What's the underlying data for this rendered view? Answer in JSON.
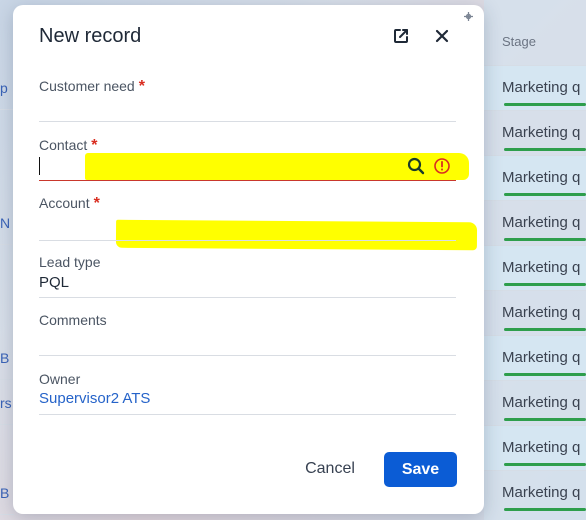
{
  "dialog": {
    "title": "New record",
    "fields": {
      "customer_need": {
        "label": "Customer need",
        "required": "*",
        "value": ""
      },
      "contact": {
        "label": "Contact",
        "required": "*",
        "value": ""
      },
      "account": {
        "label": "Account",
        "required": "*",
        "value": ""
      },
      "lead_type": {
        "label": "Lead type",
        "value": "PQL"
      },
      "comments": {
        "label": "Comments",
        "value": ""
      },
      "owner": {
        "label": "Owner",
        "value": "Supervisor2 ATS"
      }
    },
    "cancel_label": "Cancel",
    "save_label": "Save"
  },
  "background": {
    "stage_header": "Stage",
    "stage_rows": [
      "Marketing q",
      "Marketing q",
      "Marketing q",
      "Marketing q",
      "Marketing q",
      "Marketing q",
      "Marketing q",
      "Marketing q",
      "Marketing q",
      "Marketing q"
    ],
    "left_fragments": [
      "p",
      "N",
      "B",
      "rs",
      "B"
    ]
  },
  "colors": {
    "accent": "#0b5cd5",
    "link": "#2563c9",
    "required": "#d92d20",
    "highlight": "#ffff00",
    "stage_bar": "#2e9e4c"
  }
}
